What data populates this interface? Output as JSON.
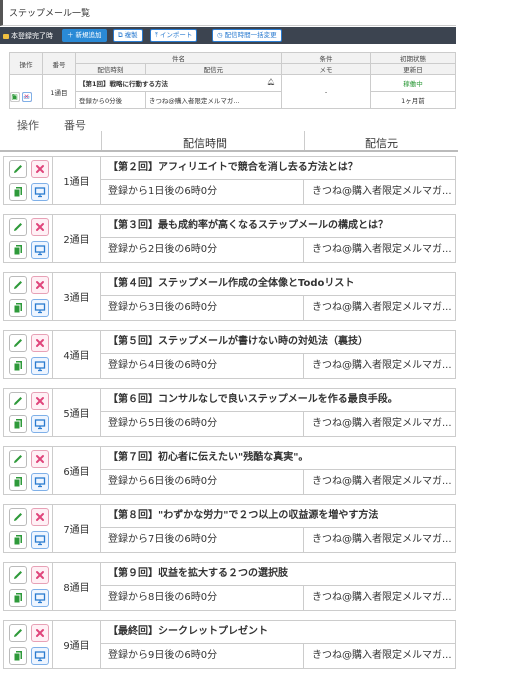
{
  "page_title": "ステップメール一覧",
  "toolbar": {
    "status_label": "本登録完了時",
    "new_label": "新規追加",
    "copy_label": "複製",
    "import_label": "インポート",
    "bulk_time_label": "配信時間一括変更"
  },
  "mini_table": {
    "headers": {
      "ops": "操作",
      "number": "番号",
      "subject": "件名",
      "send_time": "配信時刻",
      "sender": "配信元",
      "condition": "条件",
      "memo": "メモ",
      "status": "初期状態",
      "updated": "更新日"
    },
    "row": {
      "number": "1通目",
      "subject": "【第1回】戦略に行動する方法",
      "send_time": "登録から0分後",
      "sender": "きつね@購入者限定メルマガ...",
      "condition": "-",
      "status": "稼働中",
      "updated": "1ヶ月前"
    }
  },
  "table": {
    "headers": {
      "ops": "操作",
      "number": "番号",
      "send_time": "配信時間",
      "sender": "配信元"
    },
    "rows": [
      {
        "number": "1通目",
        "subject": "【第２回】アフィリエイトで競合を消し去る方法とは？",
        "send_time": "登録から1日後の6時0分",
        "sender": "きつね@購入者限定メルマガ..."
      },
      {
        "number": "2通目",
        "subject": "【第３回】最も成約率が高くなるステップメールの構成とは？",
        "send_time": "登録から2日後の6時0分",
        "sender": "きつね@購入者限定メルマガ..."
      },
      {
        "number": "3通目",
        "subject": "【第４回】ステップメール作成の全体像とTodoリスト",
        "send_time": "登録から3日後の6時0分",
        "sender": "きつね@購入者限定メルマガ..."
      },
      {
        "number": "4通目",
        "subject": "【第５回】ステップメールが書けない時の対処法（裏技）",
        "send_time": "登録から4日後の6時0分",
        "sender": "きつね@購入者限定メルマガ..."
      },
      {
        "number": "5通目",
        "subject": "【第６回】コンサルなしで良いステップメールを作る最良手段。",
        "send_time": "登録から5日後の6時0分",
        "sender": "きつね@購入者限定メルマガ..."
      },
      {
        "number": "6通目",
        "subject": "【第７回】初心者に伝えたい\"残酷な真実\"。",
        "send_time": "登録から6日後の6時0分",
        "sender": "きつね@購入者限定メルマガ..."
      },
      {
        "number": "7通目",
        "subject": "【第８回】\"わずかな労力\"で２つ以上の収益源を増やす方法",
        "send_time": "登録から7日後の6時0分",
        "sender": "きつね@購入者限定メルマガ..."
      },
      {
        "number": "8通目",
        "subject": "【第９回】収益を拡大する２つの選択肢",
        "send_time": "登録から8日後の6時0分",
        "sender": "きつね@購入者限定メルマガ..."
      },
      {
        "number": "9通目",
        "subject": "【最終回】シークレットプレゼント",
        "send_time": "登録から9日後の6時0分",
        "sender": "きつね@購入者限定メルマガ..."
      }
    ]
  },
  "icons": {
    "edit": "pencil-icon",
    "delete": "x-icon",
    "copy": "copy-icon",
    "test": "monitor-icon",
    "bell": "bell-icon"
  },
  "colors": {
    "toolbar_bg": "#3c4450",
    "primary": "#2a8ad6",
    "active_status": "#2e9a3a",
    "delete": "#e0457b",
    "edit": "#2e9a3a"
  }
}
